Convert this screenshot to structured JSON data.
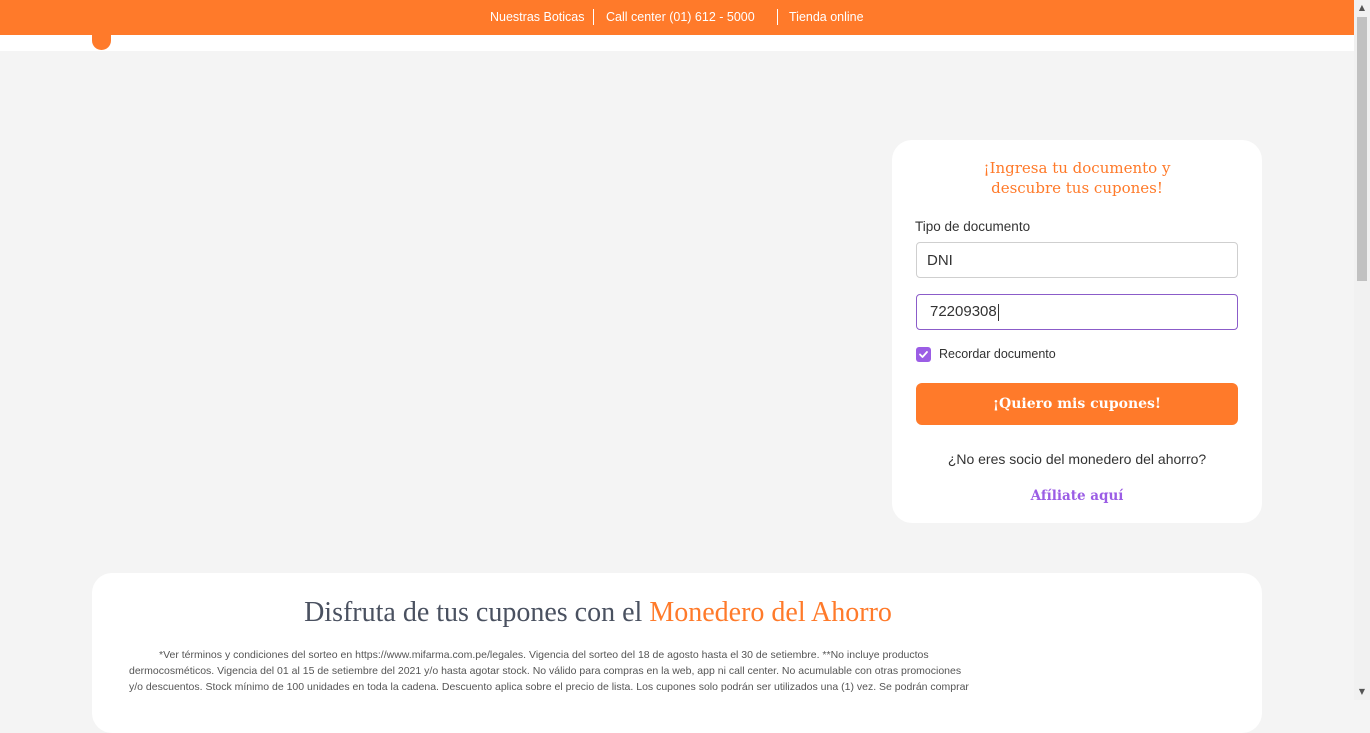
{
  "topbar": {
    "links": [
      "Nuestras Boticas",
      "Call center (01) 612 - 5000",
      "Tienda online"
    ]
  },
  "login": {
    "title_line1": "¡Ingresa tu documento y",
    "title_line2": "descubre tus cupones!",
    "doc_type_label": "Tipo de documento",
    "doc_type_value": "DNI",
    "doc_number_value": "72209308",
    "remember_checked": true,
    "remember_label": "Recordar documento",
    "submit_label": "¡Quiero mis cupones!",
    "not_member_text": "¿No eres socio del monedero del ahorro?",
    "affiliate_link": "Afíliate aquí"
  },
  "promo": {
    "title_prefix": "Disfruta de tus cupones con el",
    "title_accent": "Monedero del Ahorro",
    "terms_lines": [
      "*Ver términos y condiciones del sorteo en https://www.mifarma.com.pe/legales. Vigencia del sorteo del 18 de agosto hasta el 30 de setiembre. **No incluye productos",
      "dermocosméticos. Vigencia del 01 al 15 de setiembre del 2021 y/o hasta agotar stock. No válido para compras en la web, app ni call center. No acumulable con otras promociones",
      "y/o descuentos. Stock mínimo de 100 unidades en toda la cadena. Descuento aplica sobre el precio de lista. Los cupones solo podrán ser utilizados una (1) vez. Se podrán comprar"
    ]
  },
  "colors": {
    "brand_orange": "#ff7a2a",
    "accent_purple": "#9b5de5",
    "background": "#f4f4f4"
  },
  "icons": {
    "checkbox": "checkmark-icon",
    "logo": "brand-logo-drop"
  }
}
